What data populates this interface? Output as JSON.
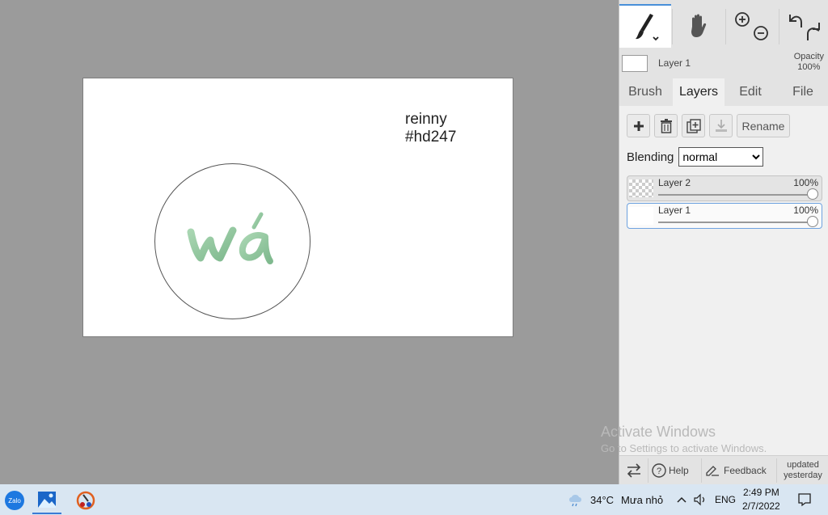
{
  "canvas": {
    "text_line1": "reinny",
    "text_line2": "#hd247",
    "artwork_text": "wá",
    "artwork_color": "#8fc79c"
  },
  "tools": {
    "brush": "brush-icon",
    "hand": "hand-icon",
    "zoom_in": "zoom-in-icon",
    "zoom_out": "zoom-out-icon",
    "undo": "undo-icon",
    "redo": "redo-icon"
  },
  "layer_info": {
    "current_layer": "Layer 1",
    "opacity_label": "Opacity",
    "opacity_value": "100%"
  },
  "tabs": [
    {
      "label": "Brush"
    },
    {
      "label": "Layers"
    },
    {
      "label": "Edit"
    },
    {
      "label": "File"
    }
  ],
  "layers_panel": {
    "rename_label": "Rename",
    "blending_label": "Blending",
    "blending_options": [
      "normal"
    ],
    "blending_value": "normal",
    "layers": [
      {
        "name": "Layer 2",
        "opacity": "100%"
      },
      {
        "name": "Layer 1",
        "opacity": "100%"
      }
    ]
  },
  "watermark": {
    "title": "Activate Windows",
    "subtitle": "Go to Settings to activate Windows."
  },
  "footer": {
    "help_label": "Help",
    "feedback_label": "Feedback",
    "updated_line1": "updated",
    "updated_line2": "yesterday"
  },
  "taskbar": {
    "zalo_label": "Zalo",
    "temperature": "34°C",
    "weather": "Mưa nhỏ",
    "language": "ENG",
    "time": "2:49 PM",
    "date": "2/7/2022"
  },
  "colors": {
    "workspace": "#9b9b9b",
    "accent": "#4a90d9",
    "taskbar": "#d9e6f2"
  }
}
